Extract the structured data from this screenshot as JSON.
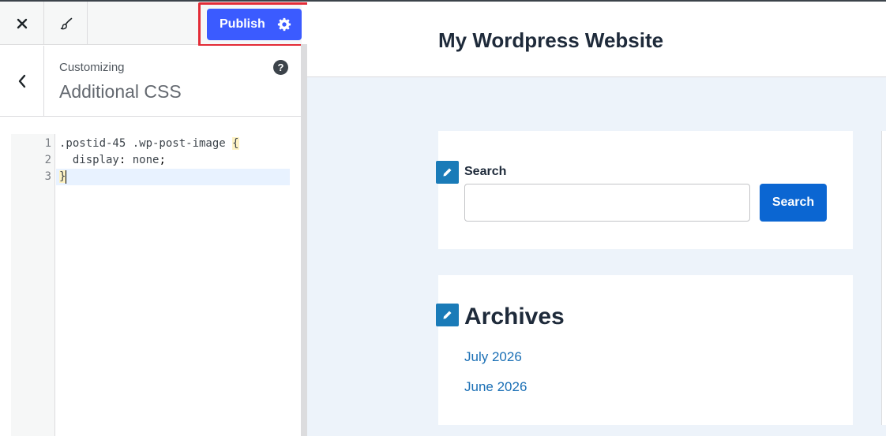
{
  "toolbar": {
    "close_icon": "close-icon",
    "brush_icon": "paintbrush-icon",
    "publish_label": "Publish",
    "settings_icon": "gear-icon"
  },
  "section": {
    "eyebrow": "Customizing",
    "title": "Additional CSS",
    "help_symbol": "?"
  },
  "editor": {
    "line_numbers": [
      "1",
      "2",
      "3"
    ],
    "lines": [
      {
        "selector": ".postid-45 .wp-post-image ",
        "brace": "{"
      },
      {
        "property": "  display",
        "separator": ": ",
        "value": "none",
        "end": ";"
      },
      {
        "brace": "}"
      }
    ]
  },
  "preview": {
    "site_title": "My Wordpress Website",
    "search_widget": {
      "label": "Search",
      "input_value": "",
      "button_label": "Search"
    },
    "archives_widget": {
      "title": "Archives",
      "links": [
        "July 2026",
        "June 2026"
      ]
    }
  },
  "colors": {
    "publish_button": "#3b5bff",
    "highlight_outline": "#e32b36",
    "search_button": "#0b66d2",
    "edit_shortcut": "#1a7bb8",
    "preview_background": "#edf3fa",
    "link": "#1a6fb5"
  }
}
